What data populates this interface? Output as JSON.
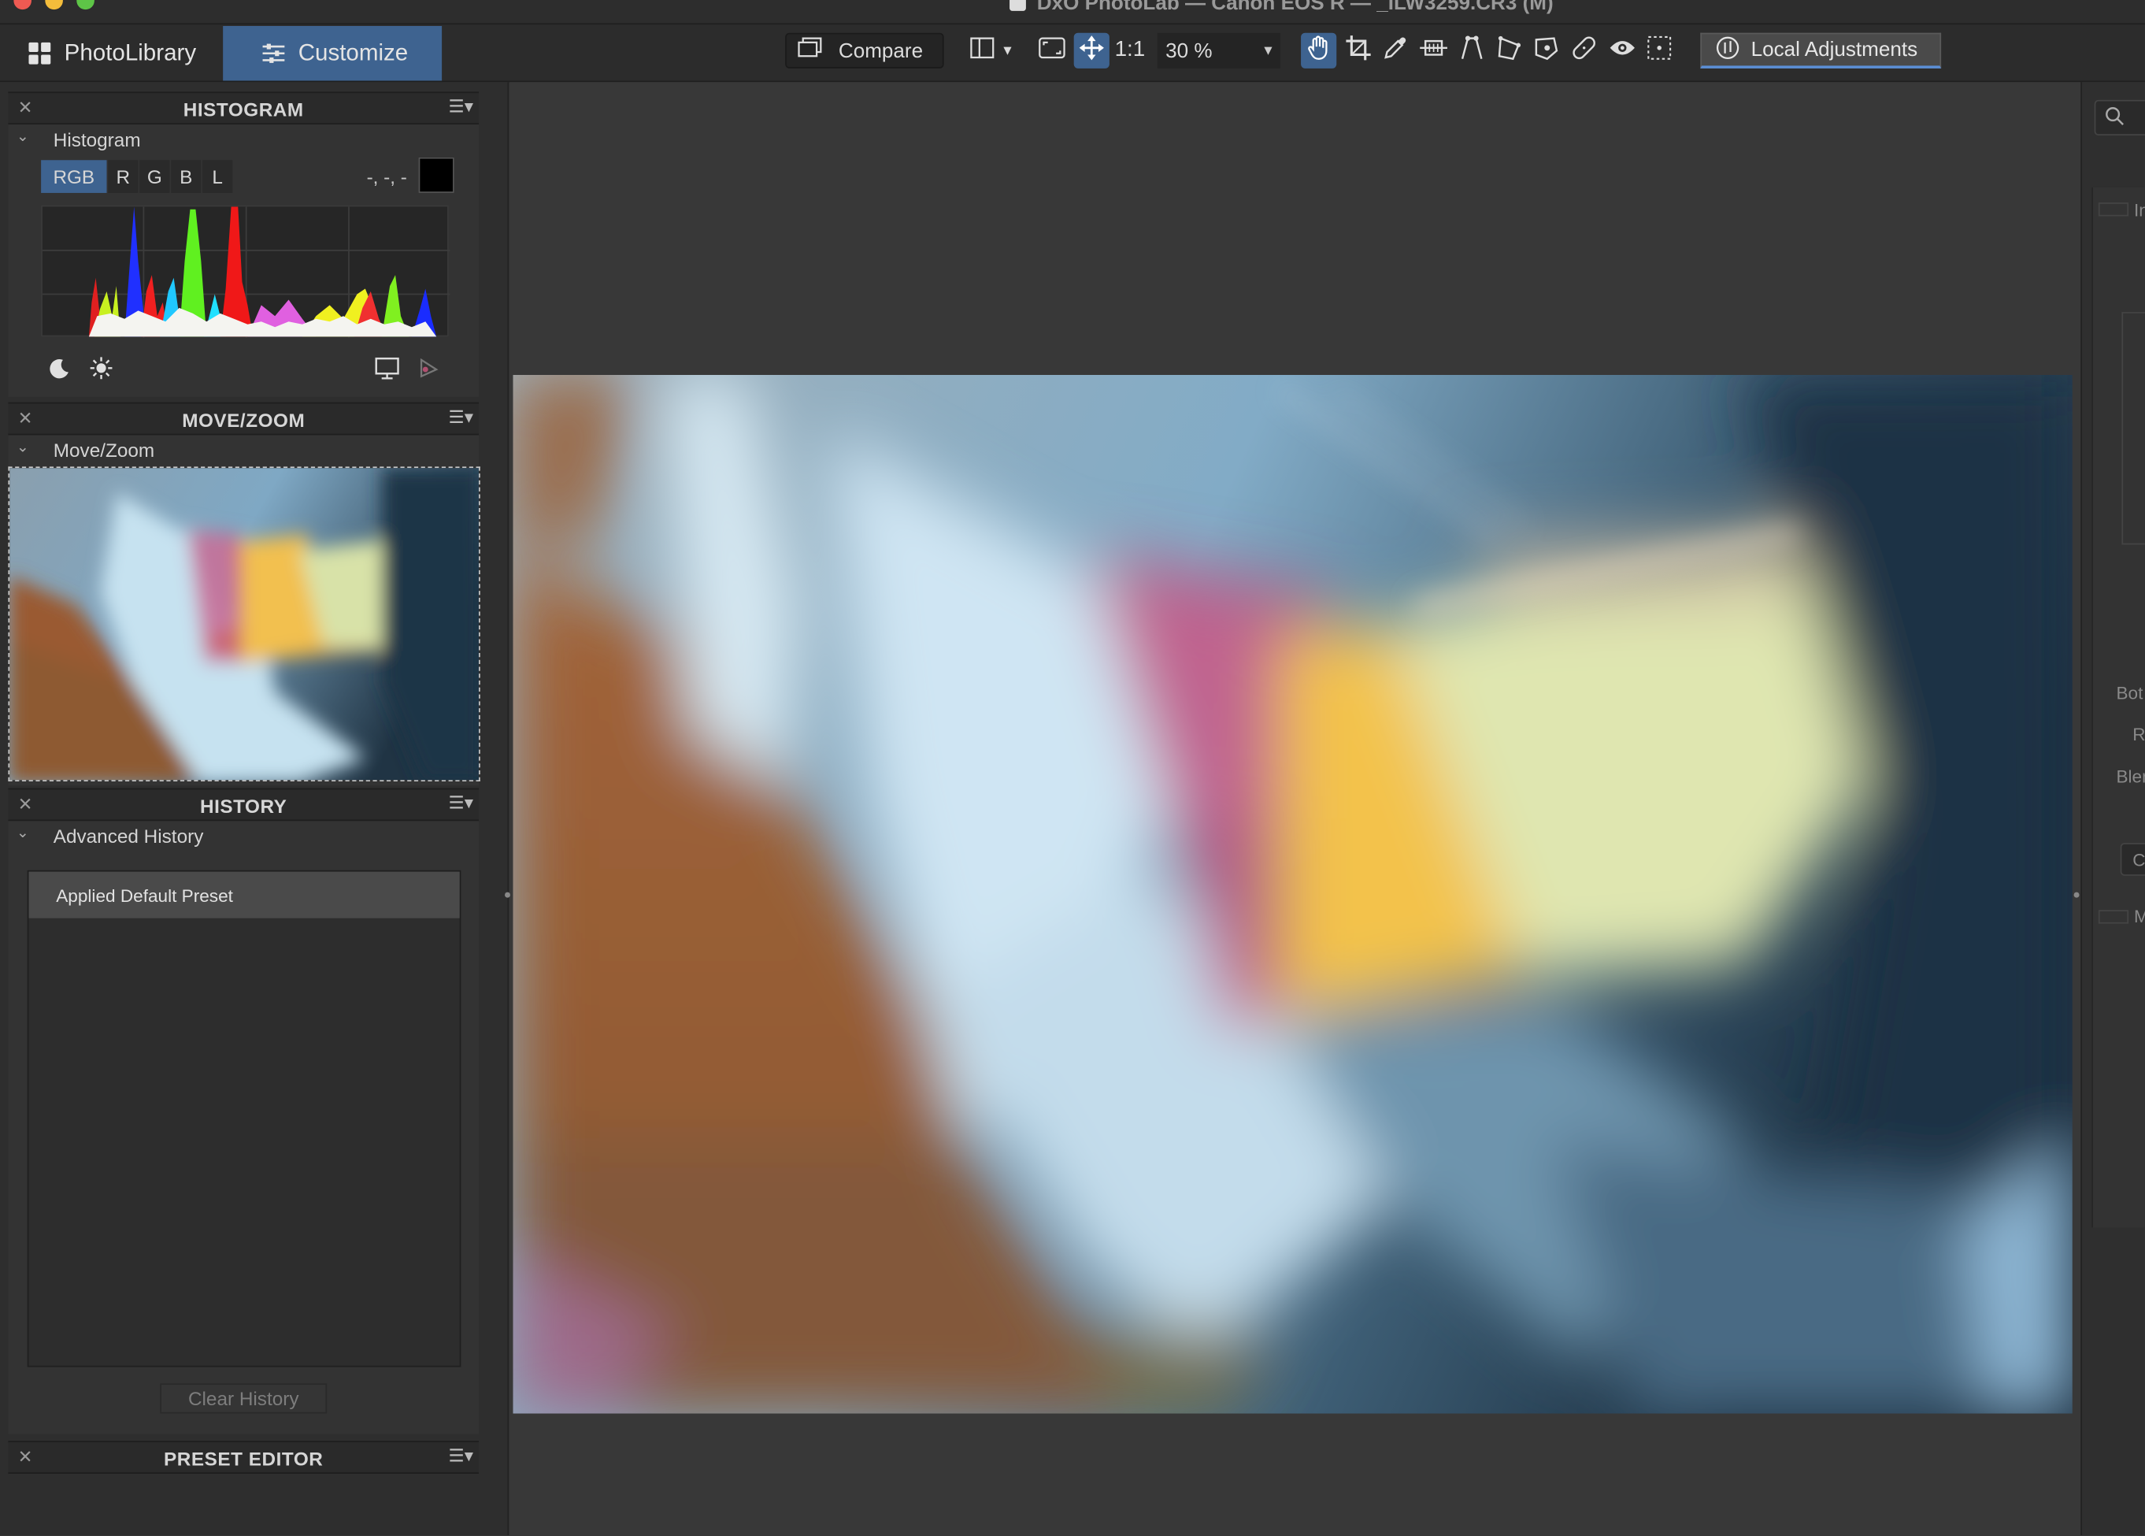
{
  "window": {
    "title": "DxO PhotoLab — Canon EOS R — _ILW3259.CR3 (M)"
  },
  "modes": {
    "photolibrary": "PhotoLibrary",
    "customize": "Customize"
  },
  "toolbar": {
    "compare_label": "Compare",
    "one_to_one": "1:1",
    "zoom_value": "30 %",
    "local_adjustments_label": "Local Adjustments"
  },
  "histogram_panel": {
    "header": "HISTOGRAM",
    "section": "Histogram",
    "channels": [
      "RGB",
      "R",
      "G",
      "B",
      "L"
    ],
    "selected_channel": "RGB",
    "pixel_values": "-, -, -",
    "swatch_color": "#000000"
  },
  "movezoom_panel": {
    "header": "MOVE/ZOOM",
    "section": "Move/Zoom"
  },
  "history_panel": {
    "header": "HISTORY",
    "section": "Advanced History",
    "items": [
      "Applied Default Preset"
    ],
    "clear_label": "Clear History"
  },
  "preset_editor_panel": {
    "header": "PRESET EDITOR"
  },
  "right_panel": {
    "labels": [
      "In",
      "Bot",
      "R",
      "Blen",
      "C",
      "M"
    ]
  },
  "colors": {
    "accent": "#3e6390",
    "local_adj_underline": "#5b8fd6"
  }
}
